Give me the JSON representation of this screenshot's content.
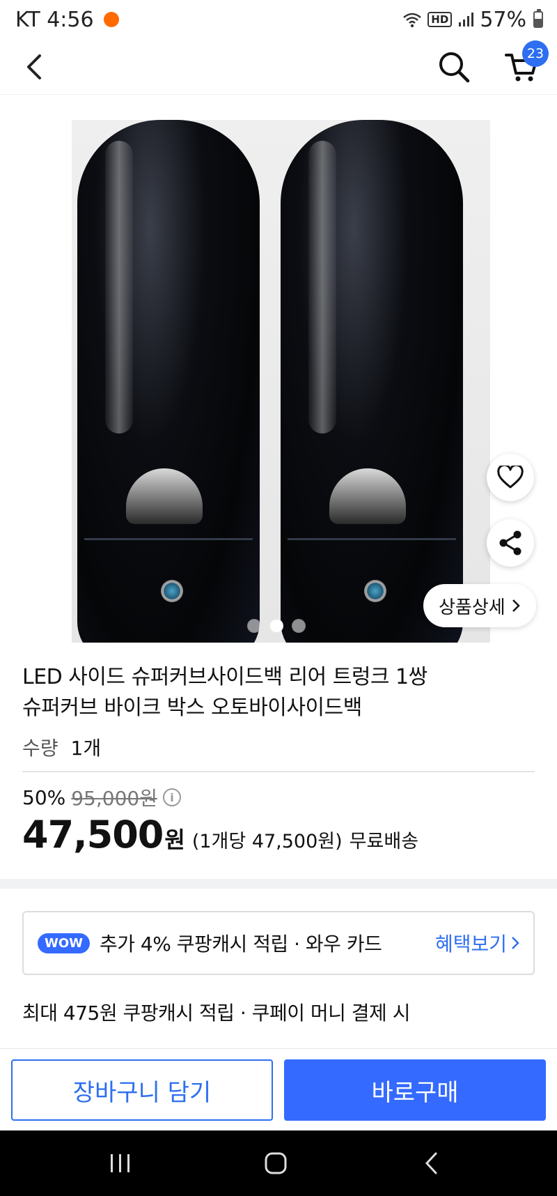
{
  "status_bar": {
    "carrier_time": "KT 4:56",
    "hd": "HD",
    "battery": "57%",
    "battery_level": 0.57
  },
  "header": {
    "cart_count": "23",
    "icons": [
      "back-icon",
      "search-icon",
      "cart-icon"
    ]
  },
  "gallery": {
    "total_images": 3,
    "active_index": 1,
    "detail_label": "상품상세"
  },
  "product": {
    "title_line1": "LED 사이드 슈퍼커브사이드백 리어 트렁크 1쌍",
    "title_line2": "슈퍼커브 바이크 박스 오토바이사이드백",
    "quantity_label": "수량",
    "quantity_value": "1개",
    "discount_rate": "50%",
    "original_price": "95,000원",
    "sale_price": "47,500",
    "currency": "원",
    "unit_price": "(1개당 47,500원)",
    "shipping": "무료배송"
  },
  "benefit": {
    "badge": "WOW",
    "text": "추가 4% 쿠팡캐시 적립  ·  와우 카드",
    "link": "혜택보기"
  },
  "cashback": "최대 475원 쿠팡캐시 적립 · 쿠페이 머니 결제 시",
  "actions": {
    "add_to_cart": "장바구니 담기",
    "buy_now": "바로구매"
  },
  "colors": {
    "accent": "#346aff",
    "link": "#2d6ff0",
    "badge": "#2d6ff0"
  }
}
